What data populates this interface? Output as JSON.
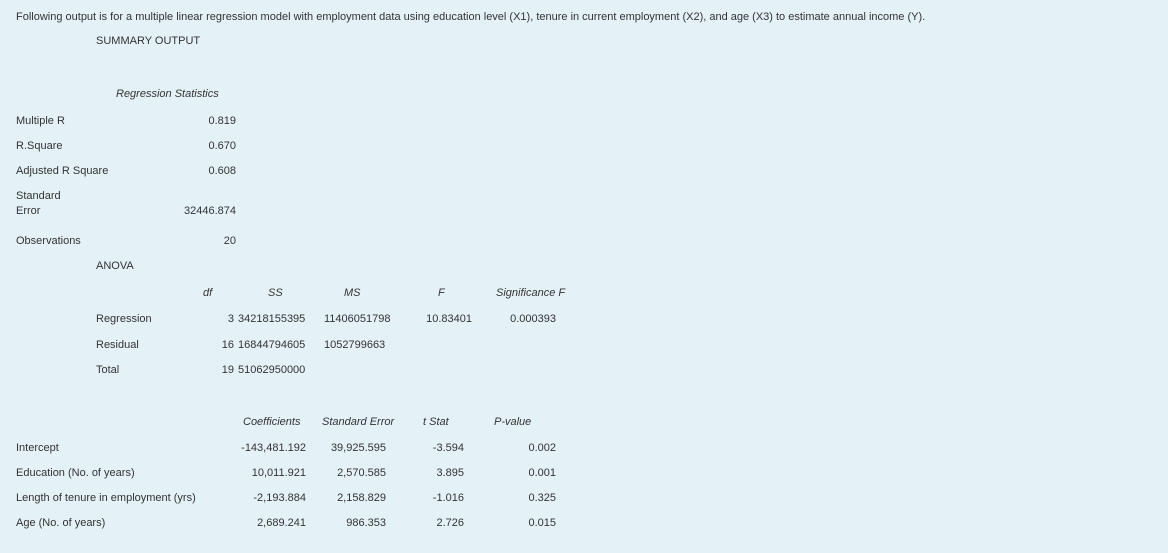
{
  "intro": "Following output is for a multiple linear regression model with employment data using education level (X1), tenure in current employment (X2), and age (X3) to estimate annual income (Y).",
  "summary_title": "SUMMARY OUTPUT",
  "regression_statistics": {
    "header": "Regression Statistics",
    "rows": [
      {
        "label": "Multiple R",
        "value": "0.819"
      },
      {
        "label": "R.Square",
        "value": "0.670"
      },
      {
        "label": "Adjusted R Square",
        "value": "0.608"
      },
      {
        "label_line1": "Standard",
        "label_line2": "Error",
        "value": "32446.874"
      },
      {
        "label": "Observations",
        "value": "20"
      }
    ]
  },
  "anova": {
    "title": "ANOVA",
    "headers": [
      "df",
      "SS",
      "MS",
      "F",
      "Significance F"
    ],
    "rows": [
      {
        "label": "Regression",
        "df": "3",
        "ss": "34218155395",
        "ms": "11406051798",
        "f": "10.83401",
        "sig": "0.000393"
      },
      {
        "label": "Residual",
        "df": "16",
        "ss": "16844794605",
        "ms": "1052799663"
      },
      {
        "label": "Total",
        "df": "19",
        "ss": "51062950000"
      }
    ]
  },
  "coefficients": {
    "headers": [
      "Coefficients",
      "Standard Error",
      "t Stat",
      "P-value"
    ],
    "rows": [
      {
        "label": "Intercept",
        "coef": "-143,481.192",
        "se": "39,925.595",
        "t": "-3.594",
        "p": "0.002"
      },
      {
        "label": "Education (No. of years)",
        "coef": "10,011.921",
        "se": "2,570.585",
        "t": "3.895",
        "p": "0.001"
      },
      {
        "label": "Length of tenure in employment (yrs)",
        "coef": "-2,193.884",
        "se": "2,158.829",
        "t": "-1.016",
        "p": "0.325"
      },
      {
        "label": "Age (No. of years)",
        "coef": "2,689.241",
        "se": "986.353",
        "t": "2.726",
        "p": "0.015"
      }
    ]
  }
}
